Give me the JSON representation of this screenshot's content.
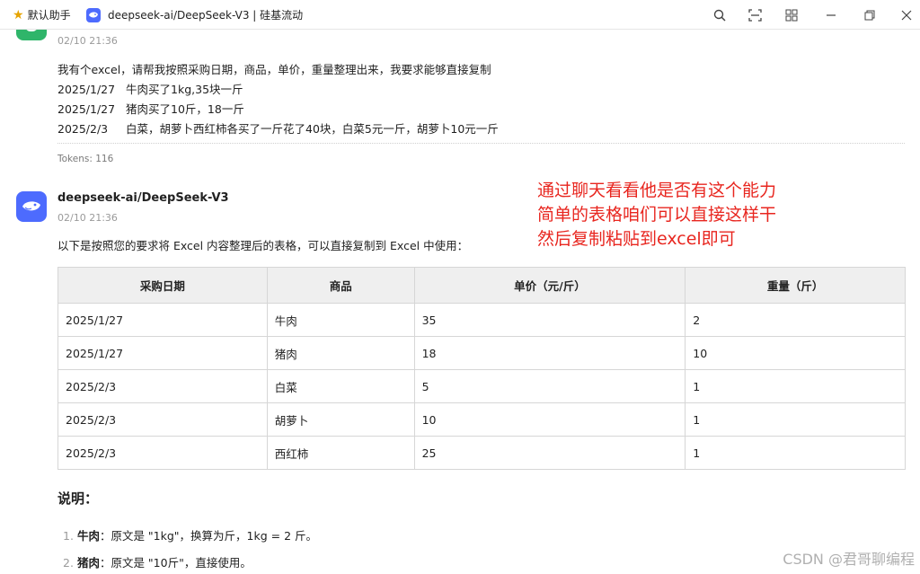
{
  "titlebar": {
    "favorites_label": "默认助手",
    "tab_title": "deepseek-ai/DeepSeek-V3 | 硅基流动",
    "icons": [
      "search-icon",
      "screenshot-icon",
      "grid-icon",
      "minimize-icon",
      "restore-icon",
      "close-icon"
    ]
  },
  "user_message": {
    "time": "02/10 21:36",
    "lines": [
      "我有个excel，请帮我按照采购日期，商品，单价，重量整理出来，我要求能够直接复制",
      "2025/1/27   牛肉买了1kg,35块一斤",
      "2025/1/27   猪肉买了10斤，18一斤",
      "2025/2/3     白菜，胡萝卜西红柿各买了一斤花了40块，白菜5元一斤，胡萝卜10元一斤"
    ],
    "tokens": "Tokens: 116"
  },
  "assistant": {
    "name": "deepseek-ai/DeepSeek-V3",
    "time": "02/10 21:36",
    "intro": "以下是按照您的要求将 Excel 内容整理后的表格，可以直接复制到 Excel 中使用：",
    "table": {
      "headers": [
        "采购日期",
        "商品",
        "单价（元/斤）",
        "重量（斤）"
      ],
      "rows": [
        [
          "2025/1/27",
          "牛肉",
          "35",
          "2"
        ],
        [
          "2025/1/27",
          "猪肉",
          "18",
          "10"
        ],
        [
          "2025/2/3",
          "白菜",
          "5",
          "1"
        ],
        [
          "2025/2/3",
          "胡萝卜",
          "10",
          "1"
        ],
        [
          "2025/2/3",
          "西红柿",
          "25",
          "1"
        ]
      ]
    },
    "notes_title": "说明：",
    "notes": [
      {
        "num": "1.",
        "bold": "牛肉",
        "text": "：原文是 \"1kg\"，换算为斤，1kg = 2 斤。"
      },
      {
        "num": "2.",
        "bold": "猪肉",
        "text": "：原文是 \"10斤\"，直接使用。"
      }
    ]
  },
  "annotation": {
    "lines": [
      "通过聊天看看他是否有这个能力",
      "简单的表格咱们可以直接这样干",
      "然后复制粘贴到excel即可"
    ],
    "color": "#e8261f"
  },
  "watermark": "CSDN @君哥聊编程",
  "colors": {
    "accent": "#4d6bfe",
    "user_avatar": "#2fb56a"
  }
}
